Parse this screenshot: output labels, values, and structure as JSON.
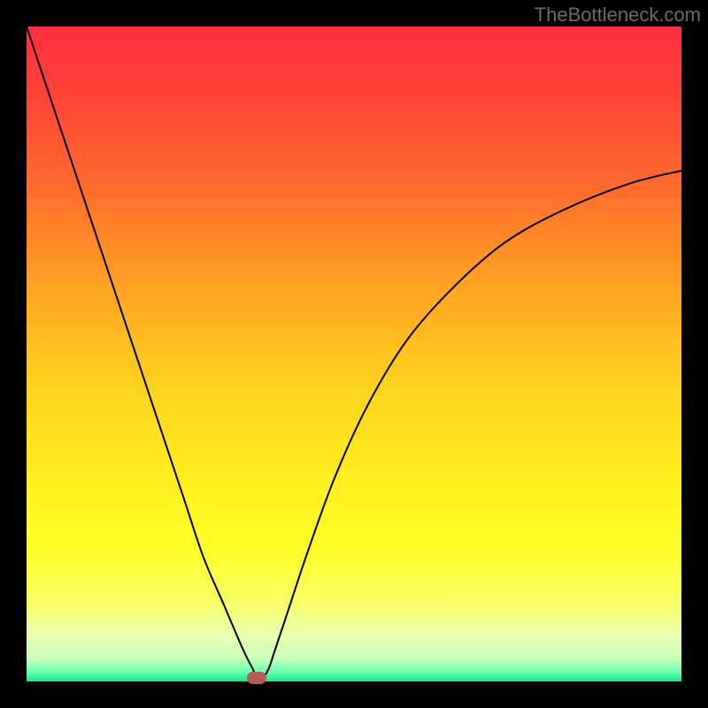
{
  "attribution": "TheBottleneck.com",
  "gradient_stops": [
    {
      "offset": 0.0,
      "color": "#ff2f3f"
    },
    {
      "offset": 0.1,
      "color": "#ff4238"
    },
    {
      "offset": 0.25,
      "color": "#ff6d2d"
    },
    {
      "offset": 0.4,
      "color": "#ffa423"
    },
    {
      "offset": 0.55,
      "color": "#ffd21e"
    },
    {
      "offset": 0.7,
      "color": "#fff01e"
    },
    {
      "offset": 0.8,
      "color": "#ffff28"
    },
    {
      "offset": 0.88,
      "color": "#f6ff66"
    },
    {
      "offset": 0.93,
      "color": "#eaffb0"
    },
    {
      "offset": 0.965,
      "color": "#c8ffb8"
    },
    {
      "offset": 0.985,
      "color": "#6bffb0"
    },
    {
      "offset": 1.0,
      "color": "#16e987"
    }
  ],
  "background_color": "#000000",
  "chart_data": {
    "type": "line",
    "title": "",
    "xlabel": "",
    "ylabel": "",
    "xlim": [
      0,
      100
    ],
    "ylim": [
      0,
      100
    ],
    "series": [
      {
        "name": "bottleneck-curve",
        "x": [
          0,
          3,
          6,
          9,
          12,
          15,
          18,
          21,
          24,
          27,
          30,
          33,
          34.5,
          35.2,
          36,
          37,
          38,
          40,
          43,
          47,
          52,
          58,
          65,
          73,
          82,
          92,
          100
        ],
        "y": [
          100,
          91,
          82,
          73,
          64,
          55,
          46,
          37,
          28,
          19,
          12,
          5,
          2,
          0.5,
          0.5,
          2,
          5,
          11,
          20,
          31,
          42,
          52,
          60,
          67,
          72,
          76,
          78
        ]
      }
    ],
    "marker": {
      "x": 35.2,
      "y": 0.5
    }
  }
}
